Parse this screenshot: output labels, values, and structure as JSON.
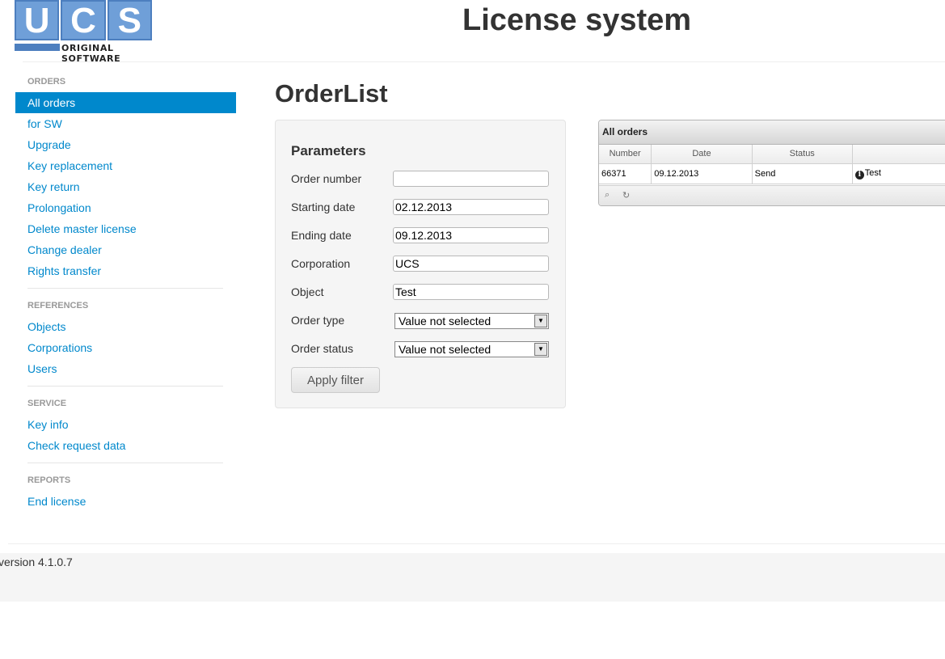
{
  "header": {
    "logo_letters": [
      "U",
      "C",
      "S"
    ],
    "logo_subtitle": "ORIGINAL SOFTWARE",
    "site_title": "License system"
  },
  "sidebar": {
    "sections": [
      {
        "header": "ORDERS",
        "items": [
          {
            "label": "All orders",
            "active": true
          },
          {
            "label": "for SW"
          },
          {
            "label": "Upgrade"
          },
          {
            "label": "Key replacement"
          },
          {
            "label": "Key return"
          },
          {
            "label": "Prolongation"
          },
          {
            "label": "Delete master license"
          },
          {
            "label": "Change dealer"
          },
          {
            "label": "Rights transfer"
          }
        ]
      },
      {
        "header": "REFERENCES",
        "items": [
          {
            "label": "Objects"
          },
          {
            "label": "Corporations"
          },
          {
            "label": "Users"
          }
        ]
      },
      {
        "header": "SERVICE",
        "items": [
          {
            "label": "Key info"
          },
          {
            "label": "Check request data"
          }
        ]
      },
      {
        "header": "REPORTS",
        "items": [
          {
            "label": "End license"
          }
        ]
      }
    ]
  },
  "main": {
    "heading": "OrderList",
    "parameters": {
      "title": "Parameters",
      "order_number": {
        "label": "Order number",
        "value": ""
      },
      "starting_date": {
        "label": "Starting date",
        "value": "02.12.2013"
      },
      "ending_date": {
        "label": "Ending date",
        "value": "09.12.2013"
      },
      "corporation": {
        "label": "Corporation",
        "value": "UCS"
      },
      "object": {
        "label": "Object",
        "value": "Test"
      },
      "order_type": {
        "label": "Order type",
        "value": "Value not selected"
      },
      "order_status": {
        "label": "Order status",
        "value": "Value not selected"
      },
      "apply_label": "Apply filter"
    },
    "grid": {
      "title": "All orders",
      "columns": [
        "Number",
        "Date",
        "Status",
        ""
      ],
      "rows": [
        {
          "number": "66371",
          "date": "09.12.2013",
          "status": "Send",
          "object": "Test"
        }
      ]
    }
  },
  "footer": {
    "version": "version 4.1.0.7"
  }
}
